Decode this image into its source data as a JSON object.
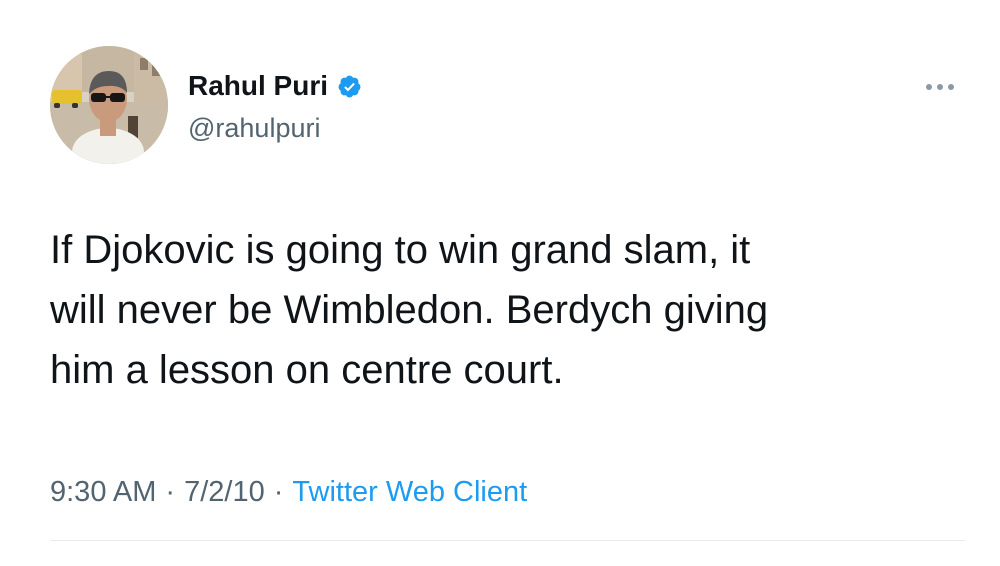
{
  "tweet": {
    "author": {
      "display_name": "Rahul Puri",
      "handle": "@rahulpuri",
      "verified": true
    },
    "text": "If Djokovic is going to win grand slam, it\nwill never be Wimbledon. Berdych giving\nhim a lesson on centre court.",
    "meta": {
      "time": "9:30 AM",
      "date": "7/2/10",
      "separator": "·",
      "source": "Twitter Web Client"
    },
    "more_icon": "more-horizontal-icon",
    "colors": {
      "text": "#0f1419",
      "muted": "#536471",
      "accent": "#1d9bf0",
      "verified_badge": "#1d9bf0",
      "divider": "#e6ecf0",
      "more_dots": "#8b98a5"
    }
  }
}
